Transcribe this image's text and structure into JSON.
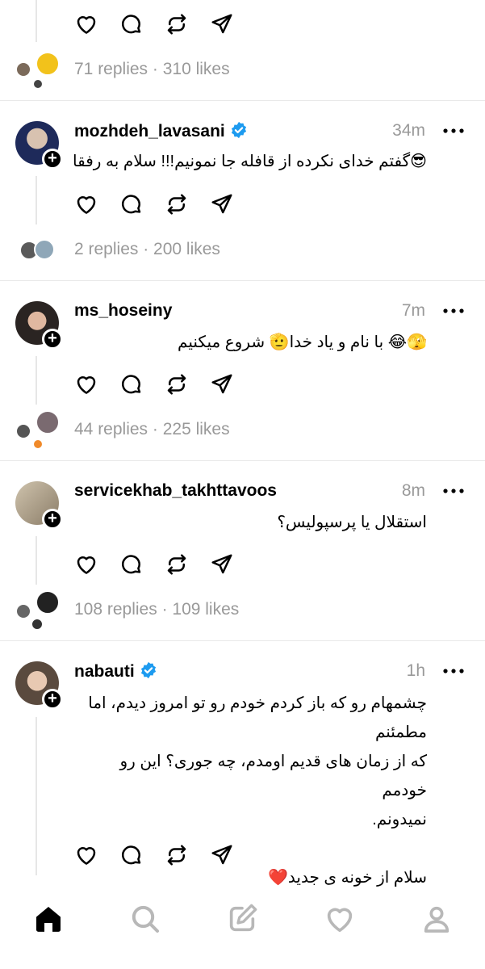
{
  "top_post": {
    "stats": "71 replies · 310 likes"
  },
  "posts": [
    {
      "username": "mozhdeh_lavasani",
      "verified": true,
      "time": "34m",
      "text": "😎گفتم خدای نکرده از قافله جا نمونیم!!! سلام به رفقا",
      "stats": "2 replies · 200 likes"
    },
    {
      "username": "ms_hoseiny",
      "verified": false,
      "time": "7m",
      "text": "🫣😂 با نام و یاد خدا🫡 شروع میکنیم",
      "stats": "44 replies · 225 likes"
    },
    {
      "username": "servicekhab_takhttavoos",
      "verified": false,
      "time": "8m",
      "text": "استقلال یا پرسپولیس؟",
      "stats": "108 replies · 109 likes"
    },
    {
      "username": "nabauti",
      "verified": true,
      "time": "1h",
      "text_lines": [
        "چشمهام رو که باز کردم خودم رو تو امروز دیدم، اما مطمئنم",
        "که از زمان های قدیم اومدم، چه جوری؟ این رو خودمم",
        "نمیدونم.",
        "",
        "سلام از خونه ی جدید❤️"
      ]
    }
  ],
  "nav": [
    "home-icon",
    "search-icon",
    "compose-icon",
    "heart-icon",
    "profile-icon"
  ],
  "colors": {
    "verified": "#1d9bf0",
    "muted": "#999999",
    "divider": "#e9e9e9"
  }
}
